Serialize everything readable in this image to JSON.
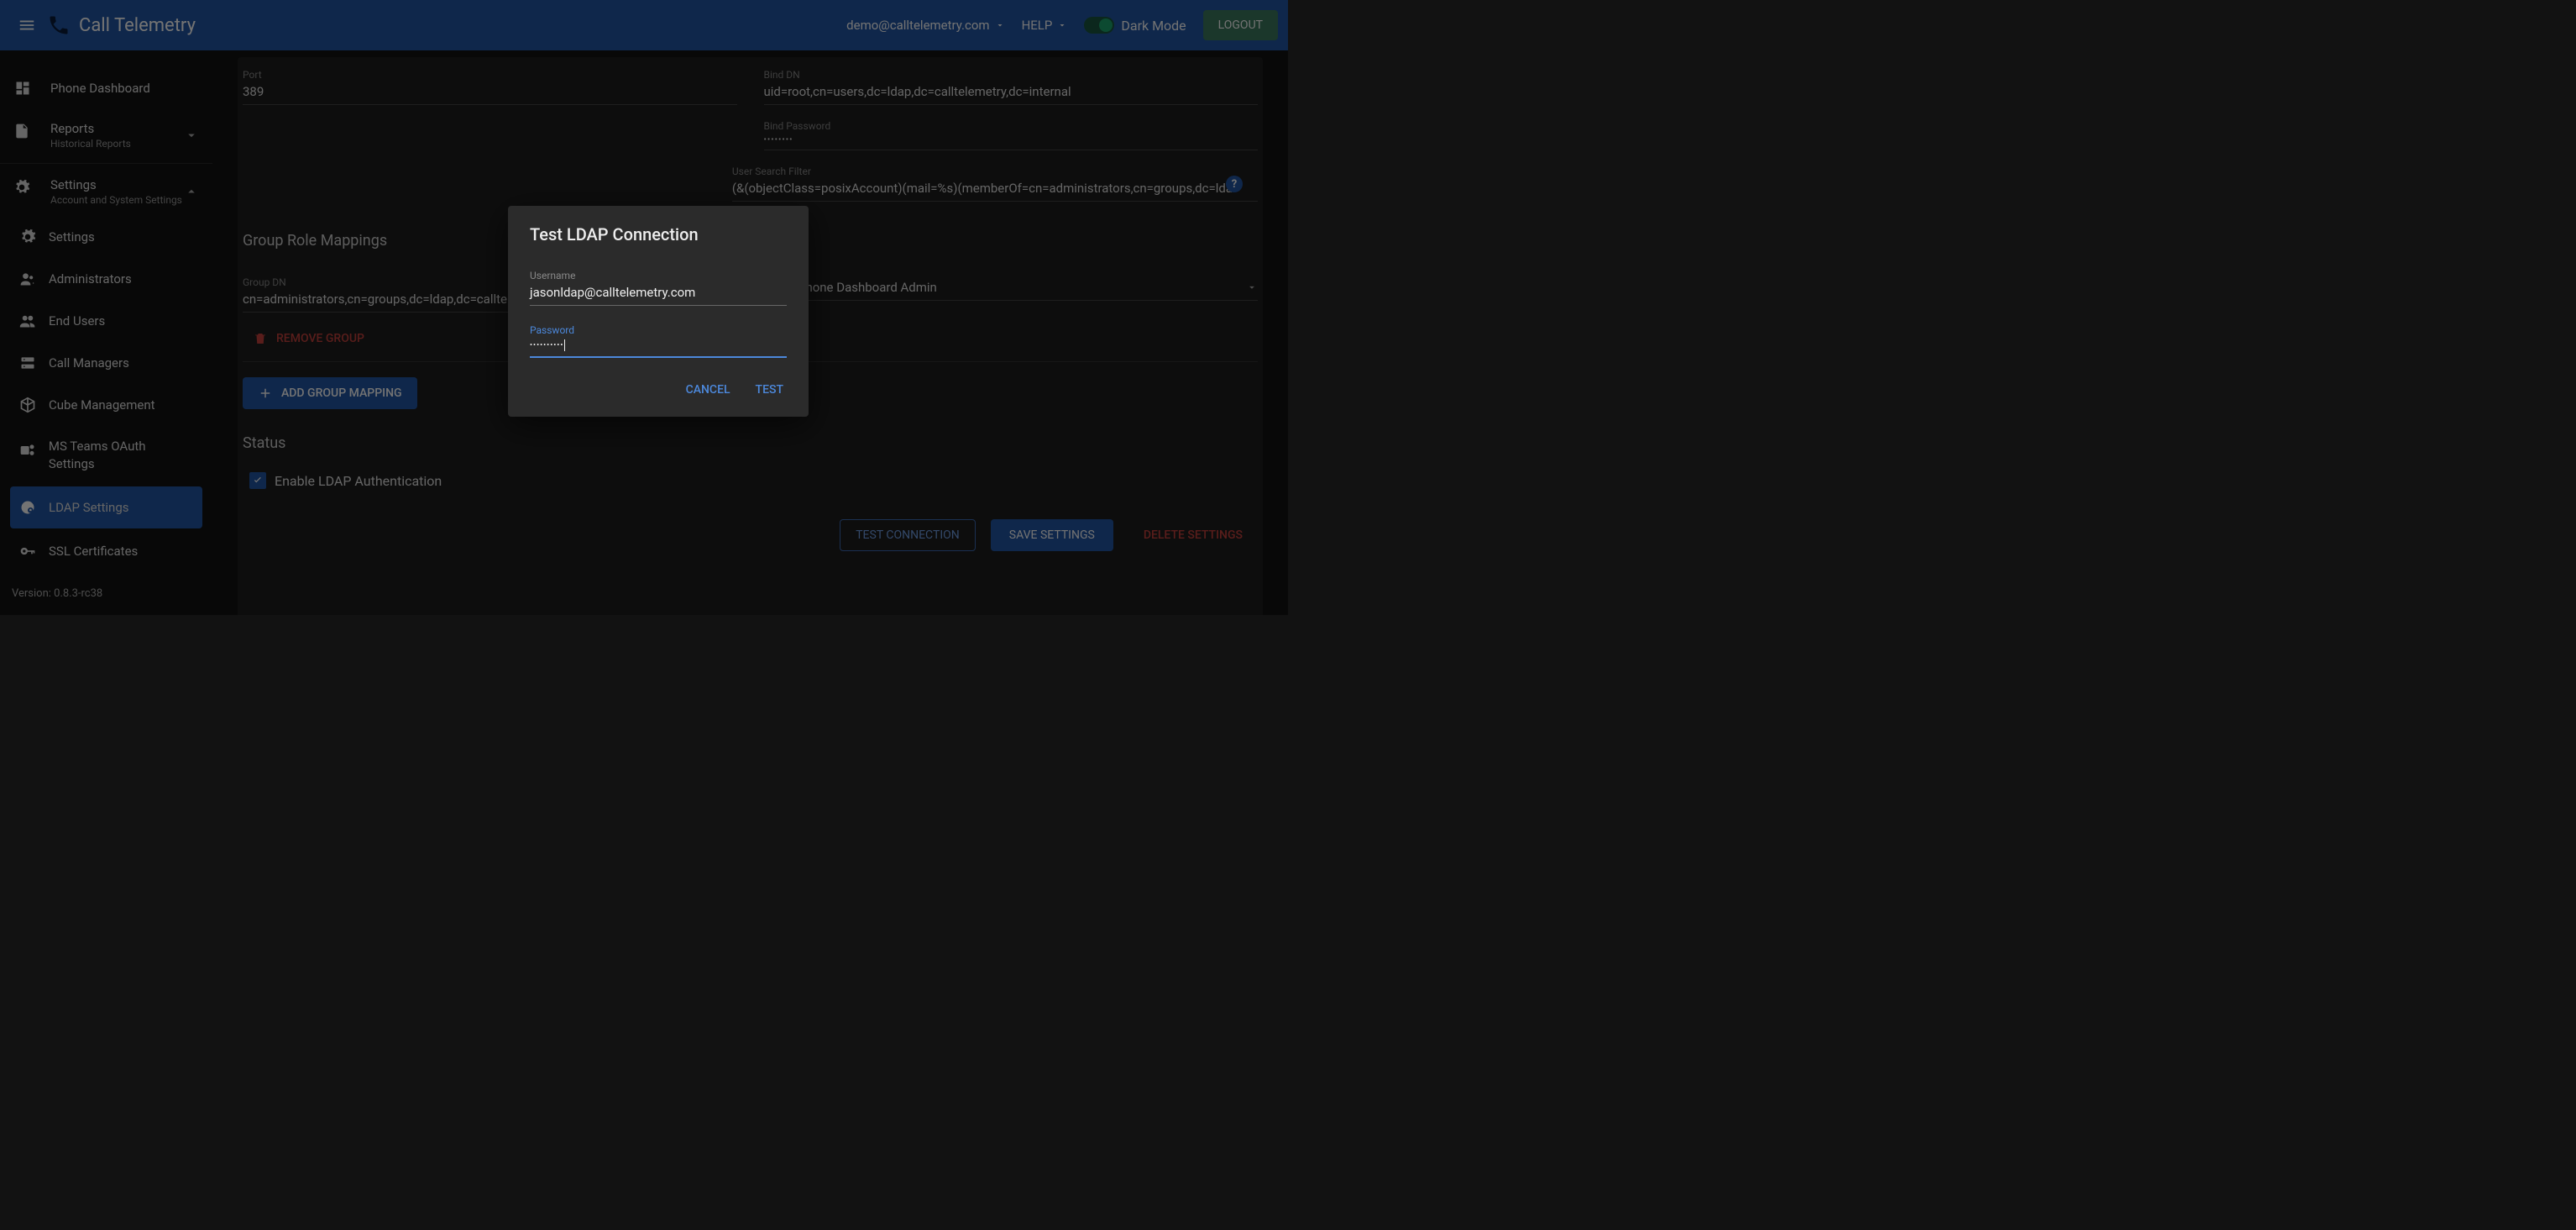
{
  "topbar": {
    "app_title": "Call Telemetry",
    "user_email": "demo@calltelemetry.com",
    "help_label": "HELP",
    "dark_mode_label": "Dark Mode",
    "logout_label": "LOGOUT"
  },
  "sidebar": {
    "phone_dashboard": "Phone Dashboard",
    "reports": {
      "label": "Reports",
      "sub": "Historical Reports"
    },
    "settings_group": {
      "label": "Settings",
      "sub": "Account and System Settings"
    },
    "items": {
      "settings": "Settings",
      "administrators": "Administrators",
      "end_users": "End Users",
      "call_managers": "Call Managers",
      "cube_management": "Cube Management",
      "ms_teams": "MS Teams OAuth Settings",
      "ldap_settings": "LDAP Settings",
      "ssl_certs": "SSL Certificates"
    },
    "version": "Version: 0.8.3-rc38"
  },
  "main": {
    "port": {
      "label": "Port",
      "value": "389"
    },
    "bind_dn": {
      "label": "Bind DN",
      "value": "uid=root,cn=users,dc=ldap,dc=calltelemetry,dc=internal"
    },
    "bind_password": {
      "label": "Bind Password",
      "value": "••••••••"
    },
    "user_search_filter": {
      "label": "User Search Filter",
      "value": "(&(objectClass=posixAccount)(mail=%s)(memberOf=cn=administrators,cn=groups,dc=lda"
    },
    "group_role_mappings_title": "Group Role Mappings",
    "group_dn": {
      "label": "Group DN",
      "value": "cn=administrators,cn=groups,dc=ldap,dc=calltele"
    },
    "roles_select": "Read, Phone Dashboard Admin",
    "remove_group": "REMOVE GROUP",
    "add_group_mapping": "ADD GROUP MAPPING",
    "status_title": "Status",
    "enable_ldap_label": "Enable LDAP Authentication",
    "test_connection": "TEST CONNECTION",
    "save_settings": "SAVE SETTINGS",
    "delete_settings": "DELETE SETTINGS"
  },
  "dialog": {
    "title": "Test LDAP Connection",
    "username_label": "Username",
    "username_value": "jasonldap@calltelemetry.com",
    "password_label": "Password",
    "password_value": "••••••••••",
    "cancel": "CANCEL",
    "test": "TEST"
  }
}
